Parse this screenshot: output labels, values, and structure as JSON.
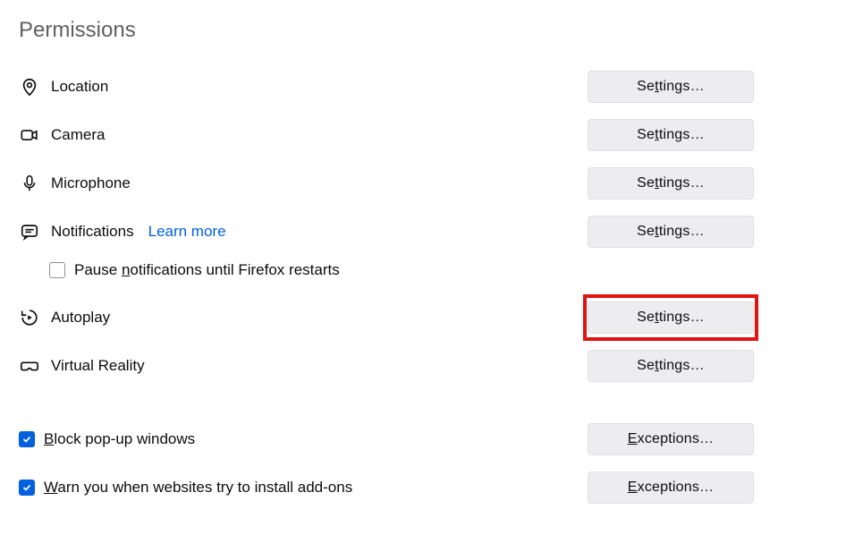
{
  "heading": "Permissions",
  "items": {
    "location": {
      "label": "Location",
      "button": "Settings…"
    },
    "camera": {
      "label": "Camera",
      "button": "Settings…"
    },
    "microphone": {
      "label": "Microphone",
      "button": "Settings…"
    },
    "notifications": {
      "label": "Notifications",
      "learn_more": "Learn more",
      "button": "Settings…"
    },
    "pause_notifications": {
      "label_pre": "Pause ",
      "label_u": "n",
      "label_post": "otifications until Firefox restarts",
      "checked": false
    },
    "autoplay": {
      "label": "Autoplay",
      "button": "Settings…"
    },
    "vr": {
      "label": "Virtual Reality",
      "button": "Settings…"
    }
  },
  "checkboxes": {
    "popups": {
      "label_u": "B",
      "label_post": "lock pop-up windows",
      "button_u": "E",
      "button_post": "xceptions…",
      "checked": true
    },
    "addons": {
      "label_u": "W",
      "label_post": "arn you when websites try to install add-ons",
      "button_u": "E",
      "button_post": "xceptions…",
      "checked": true
    }
  },
  "btn_u": "t",
  "btn_pre": "Se",
  "btn_post": "tings…"
}
